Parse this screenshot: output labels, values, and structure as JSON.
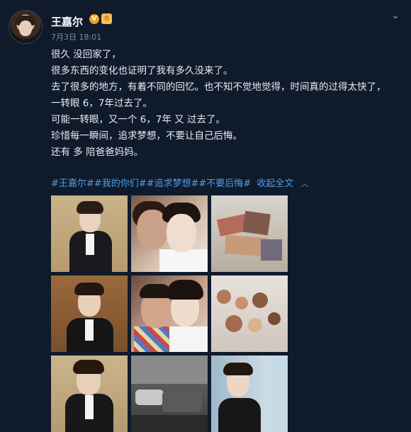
{
  "post": {
    "username": "王嘉尔",
    "verified_badge": "V",
    "member_badge": "♔",
    "date": "7月3日",
    "time": "18:01",
    "content_lines": [
      "很久 没回家了，",
      "很多东西的变化也证明了我有多久没来了。",
      "去了很多的地方，有着不同的回忆。也不知不觉地觉得，时间真的过得太快了，",
      "一转眼 6，7年过去了。",
      "可能一转眼，又一个 6，7年 又 过去了。",
      "珍惜每一瞬间，追求梦想，不要让自己后悔。",
      "还有 多 陪爸爸妈妈。"
    ],
    "hashtags": [
      "#王嘉尔#",
      "#我的你们#",
      "#追求梦想#",
      "#不要后悔#"
    ],
    "collapse_label": "收起全文",
    "collapse_icon": "chevron-up-icon"
  },
  "colors": {
    "background": "#0f1a2b",
    "link": "#4f9de6",
    "meta": "#7f8ea6"
  },
  "photos": [
    {
      "subject": "portrait-suit"
    },
    {
      "subject": "selfie-with-mother"
    },
    {
      "subject": "snack-pile"
    },
    {
      "subject": "portrait-suit"
    },
    {
      "subject": "selfie-with-father"
    },
    {
      "subject": "food-on-table"
    },
    {
      "subject": "portrait-suit"
    },
    {
      "subject": "street-cars"
    },
    {
      "subject": "portrait-suit"
    }
  ]
}
